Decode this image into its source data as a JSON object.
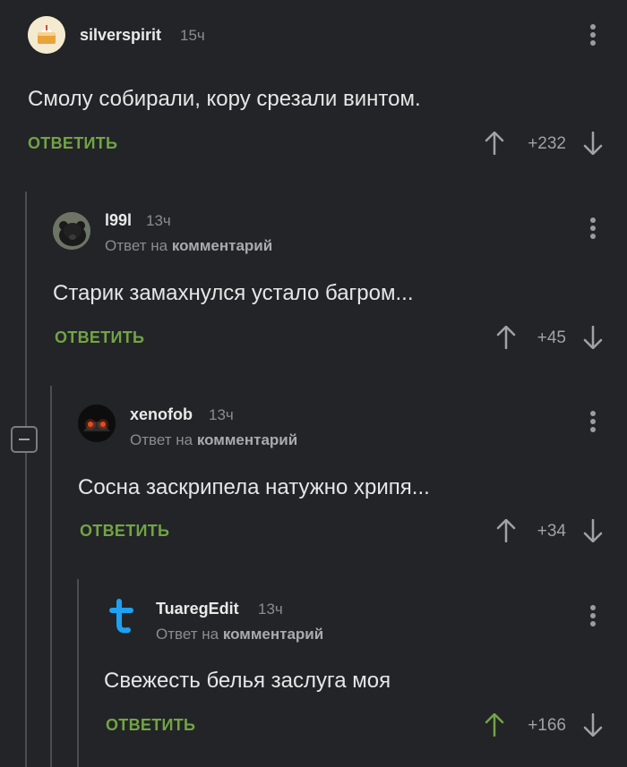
{
  "comments": [
    {
      "username": "silverspirit",
      "time": "15ч",
      "reply_prefix": "",
      "reply_target": "",
      "text": "Смолу собирали, кору срезали винтом.",
      "reply_label": "ОТВЕТИТЬ",
      "score": "+232",
      "avatar_icon": "cake-avatar",
      "upvoted": false
    },
    {
      "username": "l99l",
      "time": "13ч",
      "reply_prefix": "Ответ на",
      "reply_target": "комментарий",
      "text": "Старик замахнулся устало багром...",
      "reply_label": "ОТВЕТИТЬ",
      "score": "+45",
      "avatar_icon": "bear-avatar",
      "upvoted": false
    },
    {
      "username": "xenofob",
      "time": "13ч",
      "reply_prefix": "Ответ на",
      "reply_target": "комментарий",
      "text": "Сосна заскрипела натужно хрипя...",
      "reply_label": "ОТВЕТИТЬ",
      "score": "+34",
      "avatar_icon": "dark-robot-avatar",
      "upvoted": false
    },
    {
      "username": "TuaregEdit",
      "time": "13ч",
      "reply_prefix": "Ответ на",
      "reply_target": "комментарий",
      "text": "Свежесть белья заслуга моя",
      "reply_label": "ОТВЕТИТЬ",
      "score": "+166",
      "avatar_icon": "letter-t-avatar",
      "upvoted": true
    }
  ],
  "colors": {
    "background": "#222427",
    "accent_green": "#72a444",
    "username": "#e9e9e9",
    "muted": "#8a8c8f"
  }
}
